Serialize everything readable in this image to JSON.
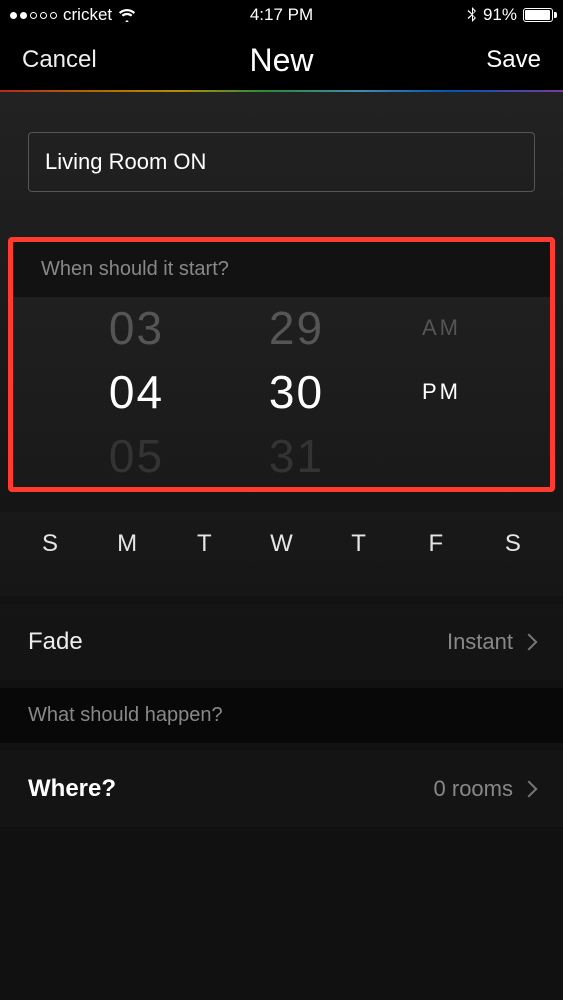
{
  "status": {
    "carrier": "cricket",
    "signal_filled": 2,
    "signal_total": 5,
    "time": "4:17 PM",
    "battery_pct": "91%"
  },
  "nav": {
    "cancel": "Cancel",
    "title": "New",
    "save": "Save"
  },
  "name_field": {
    "value": "Living Room ON"
  },
  "start_section": {
    "title": "When should it start?",
    "hour_prev": "03",
    "hour": "04",
    "hour_next": "05",
    "minute_prev": "29",
    "minute": "30",
    "minute_next": "31",
    "ampm_prev": "AM",
    "ampm": "PM",
    "days": [
      "S",
      "M",
      "T",
      "W",
      "T",
      "F",
      "S"
    ]
  },
  "fade_row": {
    "label": "Fade",
    "value": "Instant"
  },
  "happen_section": {
    "title": "What should happen?"
  },
  "where_row": {
    "label": "Where?",
    "value": "0 rooms"
  }
}
